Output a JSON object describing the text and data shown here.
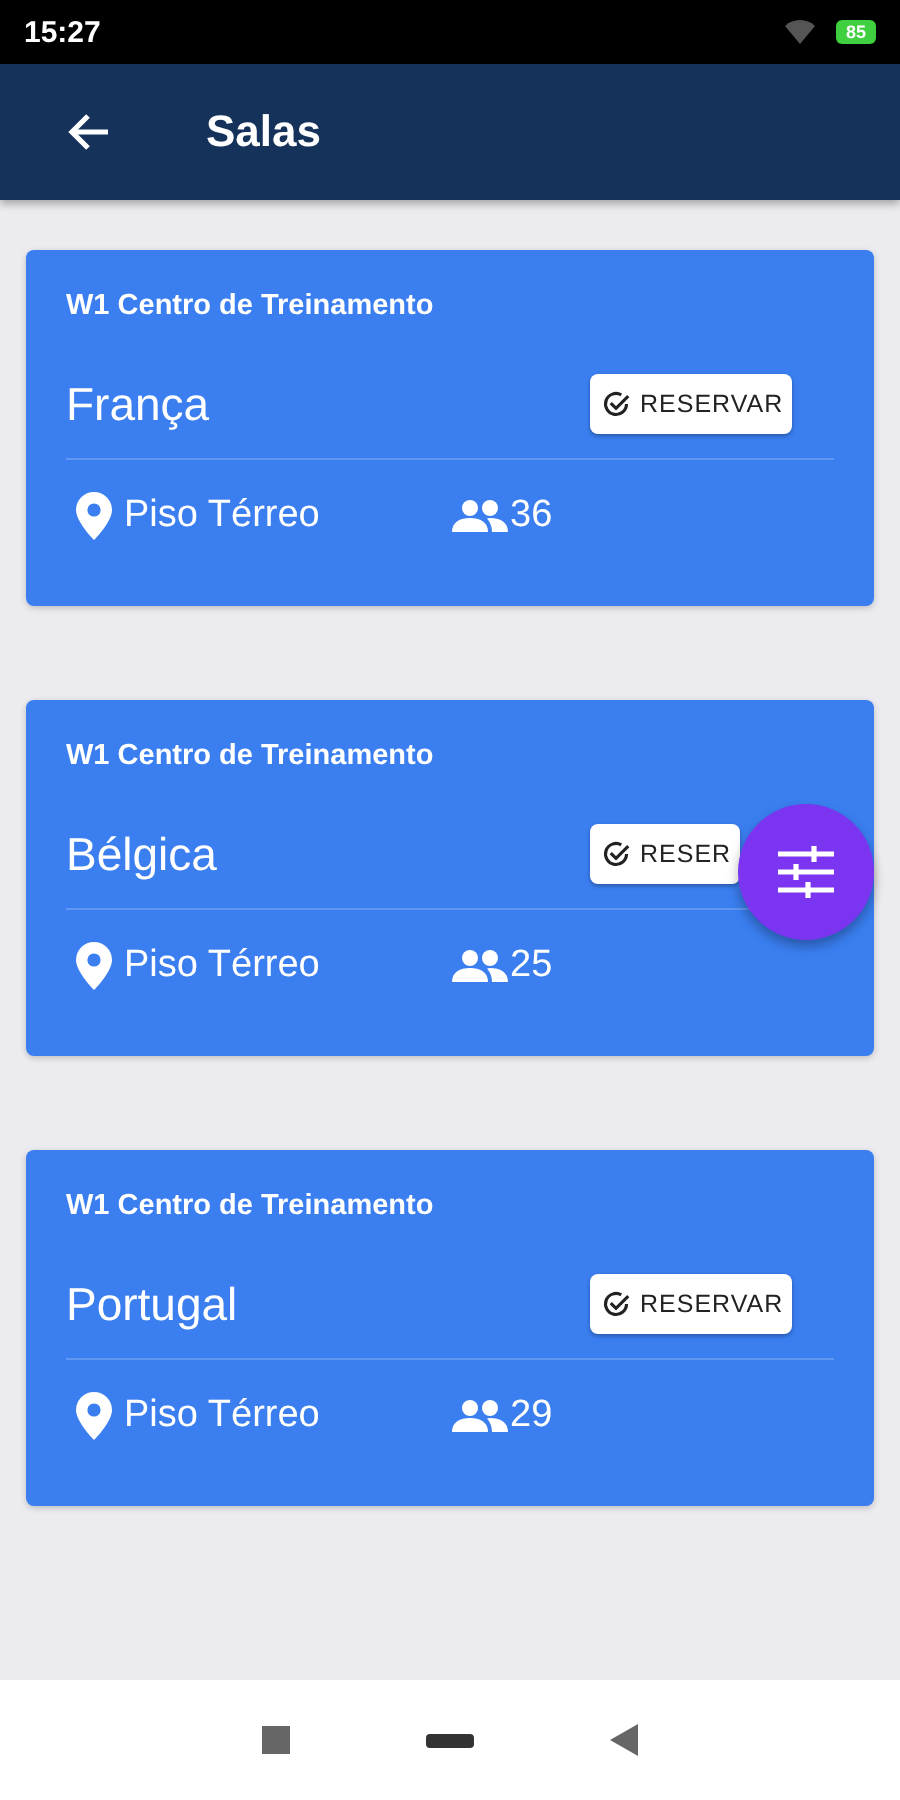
{
  "status_bar": {
    "time": "15:27",
    "battery": "85"
  },
  "app_bar": {
    "title": "Salas"
  },
  "rooms": [
    {
      "building": "W1 Centro de Treinamento",
      "name": "França",
      "button": "RESERVAR",
      "floor": "Piso Térreo",
      "capacity": "36"
    },
    {
      "building": "W1 Centro de Treinamento",
      "name": "Bélgica",
      "button": "RESER",
      "floor": "Piso Térreo",
      "capacity": "25"
    },
    {
      "building": "W1 Centro de Treinamento",
      "name": "Portugal",
      "button": "RESERVAR",
      "floor": "Piso Térreo",
      "capacity": "29"
    }
  ]
}
